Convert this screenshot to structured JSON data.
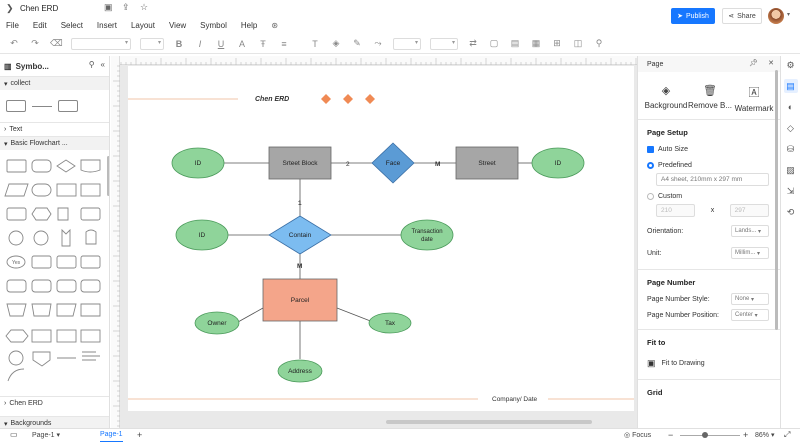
{
  "title_bar": {
    "doc_title": "Chen ERD"
  },
  "menu": [
    "File",
    "Edit",
    "Select",
    "Insert",
    "Layout",
    "View",
    "Symbol",
    "Help"
  ],
  "header_actions": {
    "publish": "Publish",
    "share": "Share"
  },
  "left_panel": {
    "title": "Symbo...",
    "categories": {
      "collect": "collect",
      "text": "Text",
      "basic_flowchart": "Basic Flowchart ...",
      "chen_erd": "Chen ERD",
      "backgrounds": "Backgrounds"
    }
  },
  "canvas": {
    "header_label": "Chen ERD",
    "footer_label": "Company/ Date",
    "nodes": {
      "id1": "ID",
      "street_block": "Srteet Block",
      "face": "Face",
      "street": "Street",
      "id2": "ID",
      "id3": "ID",
      "contain": "Contain",
      "transaction_date_1": "Transaction",
      "transaction_date_2": "date",
      "parcel": "Parcel",
      "owner": "Owner",
      "tax": "Tax",
      "address": "Address"
    },
    "cardinalities": {
      "sb_face": "2",
      "face_street": "M",
      "sb_contain": "1",
      "contain_parcel": "M"
    },
    "colors": {
      "entity": "#a6a6a6",
      "attribute": "#8fd49a",
      "relationship": "#5b9bd5",
      "contain": "#7cbcf0",
      "parcel": "#f4a58a",
      "diamond_orange": "#f08a54"
    }
  },
  "right_panel": {
    "title": "Page",
    "tools": [
      "Background",
      "Remove B...",
      "Watermark"
    ],
    "page_setup": {
      "title": "Page Setup",
      "auto_size": "Auto Size",
      "predefined": "Predefined",
      "predefined_value": "A4 sheet, 210mm x 297 mm",
      "custom": "Custom",
      "width": "210",
      "x": "x",
      "height": "297",
      "orientation_label": "Orientation:",
      "orientation_value": "Lands...",
      "unit_label": "Unit:",
      "unit_value": "Millim..."
    },
    "page_number": {
      "title": "Page Number",
      "style_label": "Page Number Style:",
      "style_value": "None",
      "position_label": "Page Number Position:",
      "position_value": "Center"
    },
    "fit_to": {
      "title": "Fit to",
      "action": "Fit to Drawing"
    },
    "grid": {
      "title": "Grid"
    }
  },
  "status_bar": {
    "page_select": "Page-1",
    "page_tab": "Page-1",
    "focus": "Focus",
    "zoom": "86%"
  }
}
